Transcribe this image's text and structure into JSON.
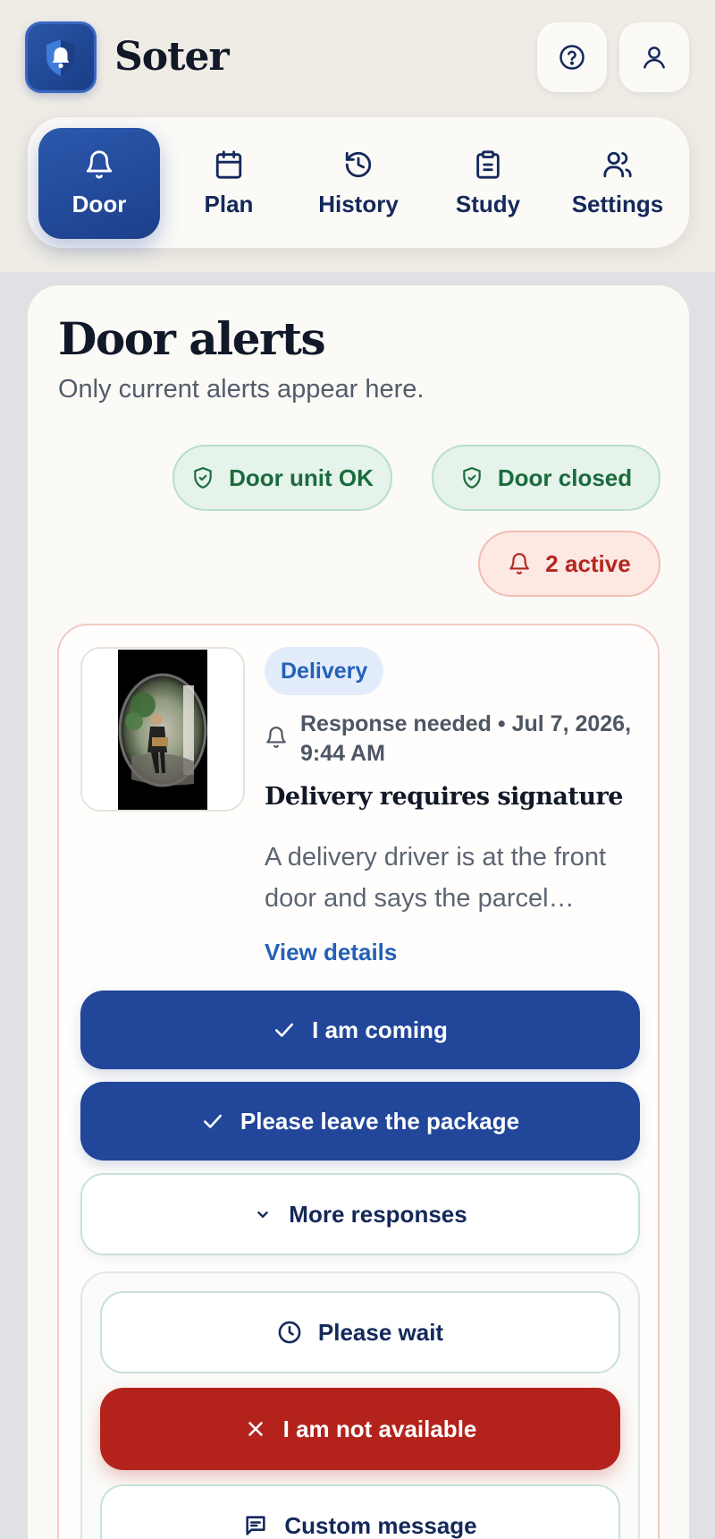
{
  "app": {
    "name": "Soter",
    "logo_icon": "bell-shield-icon"
  },
  "header": {
    "help_icon": "help-circle-icon",
    "account_icon": "user-icon"
  },
  "tabs": [
    {
      "label": "Door",
      "icon": "bell-icon",
      "active": true
    },
    {
      "label": "Plan",
      "icon": "calendar-icon",
      "active": false
    },
    {
      "label": "History",
      "icon": "history-icon",
      "active": false
    },
    {
      "label": "Study",
      "icon": "clipboard-icon",
      "active": false
    },
    {
      "label": "Settings",
      "icon": "users-icon",
      "active": false
    }
  ],
  "page": {
    "title": "Door alerts",
    "subtitle": "Only current alerts appear here."
  },
  "status": {
    "unit": "Door unit OK",
    "door": "Door closed",
    "active": "2 active"
  },
  "alert": {
    "tag": "Delivery",
    "meta": "Response needed • Jul 7, 2026, 9:44 AM",
    "title": "Delivery requires signature",
    "description": "A delivery driver is at the front door and says the parcel requires a signature.",
    "view_details": "View details"
  },
  "responses": {
    "coming": "I am coming",
    "leave_package": "Please leave the package",
    "more": "More responses",
    "wait": "Please wait",
    "not_available": "I am not available",
    "custom": "Custom message"
  },
  "colors": {
    "primary": "#21469a",
    "danger": "#b3231b",
    "ok": "#1b6b3d",
    "alert": "#b3261e",
    "link": "#2360b8"
  }
}
